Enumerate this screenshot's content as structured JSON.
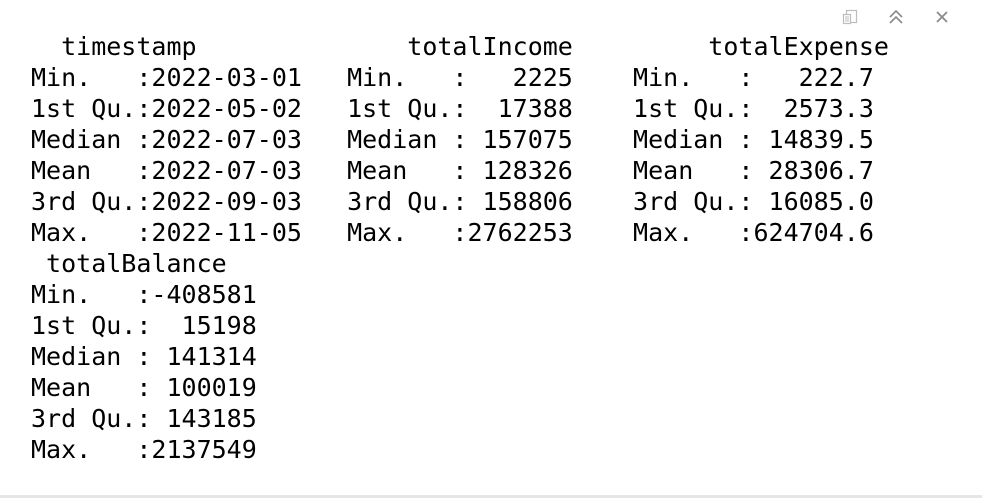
{
  "toolbar": {
    "icons": [
      "popout-icon",
      "collapse-icon",
      "close-icon"
    ]
  },
  "summary": {
    "lines": [
      "  timestamp              totalIncome         totalExpense    ",
      "Min.   :2022-03-01   Min.   :   2225    Min.   :   222.7  ",
      "1st Qu.:2022-05-02   1st Qu.:  17388    1st Qu.:  2573.3  ",
      "Median :2022-07-03   Median : 157075    Median : 14839.5  ",
      "Mean   :2022-07-03   Mean   : 128326    Mean   : 28306.7  ",
      "3rd Qu.:2022-09-03   3rd Qu.: 158806    3rd Qu.: 16085.0  ",
      "Max.   :2022-11-05   Max.   :2762253    Max.   :624704.6  ",
      " totalBalance   ",
      "Min.   :-408581  ",
      "1st Qu.:  15198  ",
      "Median : 141314  ",
      "Mean   : 100019  ",
      "3rd Qu.: 143185  ",
      "Max.   :2137549  "
    ]
  }
}
